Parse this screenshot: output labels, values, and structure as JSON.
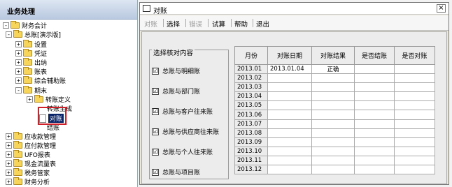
{
  "nav": {
    "header": "业务处理",
    "items": [
      {
        "label": "财务会计",
        "expander": "-",
        "indent": 0
      },
      {
        "label": "总账[演示版]",
        "expander": "-",
        "indent": 1
      },
      {
        "label": "设置",
        "expander": "+",
        "indent": 2
      },
      {
        "label": "凭证",
        "expander": "+",
        "indent": 2
      },
      {
        "label": "出纳",
        "expander": "+",
        "indent": 2
      },
      {
        "label": "账表",
        "expander": "+",
        "indent": 2
      },
      {
        "label": "综合辅助账",
        "expander": "+",
        "indent": 2
      },
      {
        "label": "期末",
        "expander": "-",
        "indent": 2
      },
      {
        "label": "转账定义",
        "expander": "+",
        "indent": 3
      },
      {
        "label": "转账生成",
        "expander": "",
        "indent": 3
      },
      {
        "label": "对账",
        "expander": "",
        "indent": 3
      },
      {
        "label": "结账",
        "expander": "",
        "indent": 3
      },
      {
        "label": "应收款管理",
        "expander": "+",
        "indent": 1
      },
      {
        "label": "应付款管理",
        "expander": "+",
        "indent": 1
      },
      {
        "label": "UFO报表",
        "expander": "+",
        "indent": 1
      },
      {
        "label": "现金流量表",
        "expander": "+",
        "indent": 1
      },
      {
        "label": "税务管家",
        "expander": "+",
        "indent": 1
      },
      {
        "label": "财务分析",
        "expander": "+",
        "indent": 1
      }
    ]
  },
  "dialog": {
    "title": "对账",
    "close": "×",
    "toolbar": {
      "duizhang": "对账",
      "select": "选择",
      "error": "错误",
      "trial": "试算",
      "help": "帮助",
      "exit": "退出"
    },
    "group_title": "选择核对内容",
    "checks": [
      {
        "label": "总账与明细账",
        "checked": "☑"
      },
      {
        "label": "总账与部门账",
        "checked": "☑"
      },
      {
        "label": "总账与客户往来账",
        "checked": "☑"
      },
      {
        "label": "总账与供应商往来账",
        "checked": "☑"
      },
      {
        "label": "总账与个人往来账",
        "checked": "☑"
      },
      {
        "label": "总账与项目账",
        "checked": "☑"
      }
    ],
    "table": {
      "headers": [
        "月份",
        "对账日期",
        "对账结果",
        "是否结账",
        "是否对账"
      ],
      "rows": [
        [
          "2013.01",
          "2013.01.04",
          "正确",
          "",
          ""
        ],
        [
          "2013.02",
          "",
          "",
          "",
          ""
        ],
        [
          "2013.03",
          "",
          "",
          "",
          ""
        ],
        [
          "2013.04",
          "",
          "",
          "",
          ""
        ],
        [
          "2013.05",
          "",
          "",
          "",
          ""
        ],
        [
          "2013.06",
          "",
          "",
          "",
          ""
        ],
        [
          "2013.07",
          "",
          "",
          "",
          ""
        ],
        [
          "2013.08",
          "",
          "",
          "",
          ""
        ],
        [
          "2013.09",
          "",
          "",
          "",
          ""
        ],
        [
          "2013.10",
          "",
          "",
          "",
          ""
        ],
        [
          "2013.11",
          "",
          "",
          "",
          ""
        ],
        [
          "2013.12",
          "",
          "",
          "",
          ""
        ]
      ]
    }
  }
}
